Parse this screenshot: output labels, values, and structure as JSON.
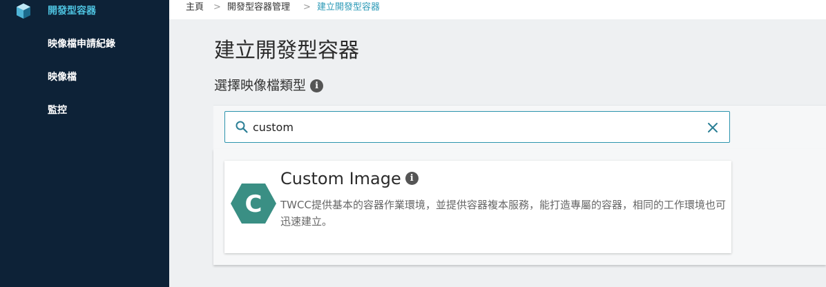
{
  "sidebar": {
    "items": [
      {
        "label": "開發型容器",
        "active": true,
        "icon": "container-cube-icon"
      },
      {
        "label": "映像檔申請紀錄",
        "active": false
      },
      {
        "label": "映像檔",
        "active": false
      },
      {
        "label": "監控",
        "active": false
      }
    ]
  },
  "breadcrumb": {
    "items": [
      "主頁",
      "開發型容器管理",
      "建立開發型容器"
    ],
    "separator": ">"
  },
  "page": {
    "title": "建立開發型容器",
    "section_title": "選擇映像檔類型",
    "info_icon": "i"
  },
  "search": {
    "value": "custom",
    "icon": "search-icon",
    "clear_icon": "close-icon"
  },
  "result": {
    "title": "Custom Image",
    "logo_letter": "C",
    "description": "TWCC提供基本的容器作業環境，並提供容器複本服務，能打造專屬的容器，相同的工作環境也可迅速建立。"
  },
  "colors": {
    "sidebar_bg": "#0d2237",
    "active_nav": "#4ec3e0",
    "accent": "#2c9ab7",
    "logo_green": "#3a8f84"
  }
}
